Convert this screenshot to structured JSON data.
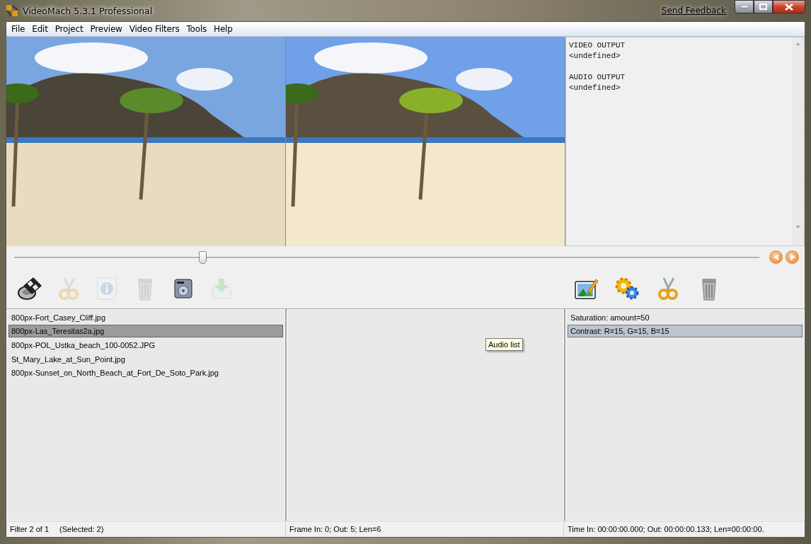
{
  "window": {
    "title": "VideoMach 5.3.1 Professional",
    "feedback_link": "Send Feedback"
  },
  "menu": [
    "File",
    "Edit",
    "Project",
    "Preview",
    "Video Filters",
    "Tools",
    "Help"
  ],
  "output_info": [
    {
      "heading": "VIDEO OUTPUT",
      "value": "<undefined>"
    },
    {
      "heading": "AUDIO OUTPUT",
      "value": "<undefined>"
    }
  ],
  "position_slider": {
    "level": 0.253
  },
  "left_toolbar": [
    {
      "kind": "film",
      "disabled": false
    },
    {
      "kind": "scissors",
      "disabled": true
    },
    {
      "kind": "info",
      "disabled": true
    },
    {
      "kind": "trash",
      "disabled": true
    },
    {
      "kind": "disk",
      "disabled": false
    },
    {
      "kind": "download",
      "disabled": true
    }
  ],
  "right_toolbar": [
    {
      "kind": "picture",
      "disabled": false
    },
    {
      "kind": "gears",
      "disabled": false
    },
    {
      "kind": "scissors",
      "disabled": false
    },
    {
      "kind": "trash",
      "disabled": false
    }
  ],
  "files": [
    {
      "name": "800px-Fort_Casey_Cliff.jpg",
      "selected": false
    },
    {
      "name": "800px-Las_Teresitas2a.jpg",
      "selected": true
    },
    {
      "name": "800px-POL_Ustka_beach_100-0052.JPG",
      "selected": false
    },
    {
      "name": "St_Mary_Lake_at_Sun_Point.jpg",
      "selected": false
    },
    {
      "name": "800px-Sunset_on_North_Beach_at_Fort_De_Soto_Park.jpg",
      "selected": false
    }
  ],
  "audio_list": {
    "tooltip": "Audio list"
  },
  "filters": [
    {
      "name": "Saturation:  amount=50",
      "selected": false
    },
    {
      "name": "Contrast:  R=15, G=15, B=15",
      "selected": true
    }
  ],
  "status_bar": [
    {
      "text": "Filter 2 of 1",
      "detail": "(Selected: 2)"
    },
    {
      "text": "Frame In: 0;  Out: 5;  Len=6"
    },
    {
      "text": "Time In: 00:00:00.000;  Out: 00:00:00.133;  Len=00:00:00."
    }
  ]
}
